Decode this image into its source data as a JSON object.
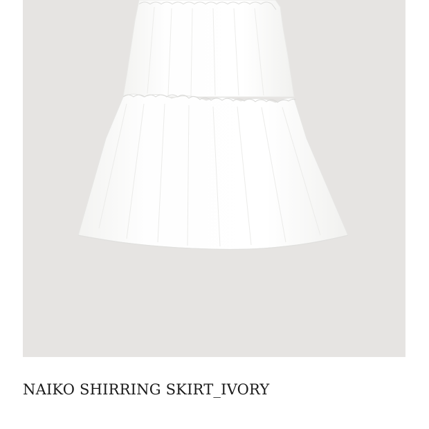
{
  "product": {
    "name": "NAIKO SHIRRING SKIRT_IVORY",
    "image_subject": "white tiered shirring skirt",
    "image_background_color": "#e6e4e2"
  },
  "gallery": {
    "next_icon": "chevron-right-icon"
  }
}
